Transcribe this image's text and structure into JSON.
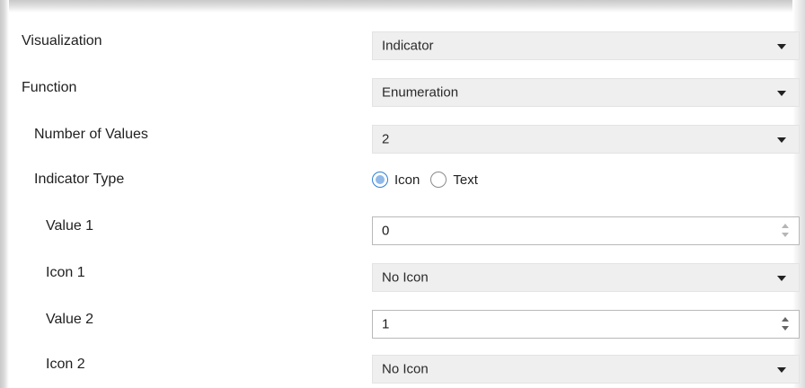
{
  "rows": {
    "visualization": {
      "label": "Visualization",
      "value": "Indicator"
    },
    "function": {
      "label": "Function",
      "value": "Enumeration"
    },
    "number_of_values": {
      "label": "Number of Values",
      "value": "2"
    },
    "indicator_type": {
      "label": "Indicator Type",
      "options": [
        "Icon",
        "Text"
      ],
      "selected": "Icon"
    },
    "value1": {
      "label": "Value 1",
      "value": "0"
    },
    "icon1": {
      "label": "Icon 1",
      "value": "No Icon"
    },
    "value2": {
      "label": "Value 2",
      "value": "1"
    },
    "icon2": {
      "label": "Icon 2",
      "value": "No Icon"
    }
  },
  "colors": {
    "combo_bg": "#efefef",
    "radio_accent": "#2d7fd6"
  },
  "icons": {
    "dropdown": "chevron-down-icon",
    "spin_up": "spin-up-icon",
    "spin_down": "spin-down-icon"
  }
}
